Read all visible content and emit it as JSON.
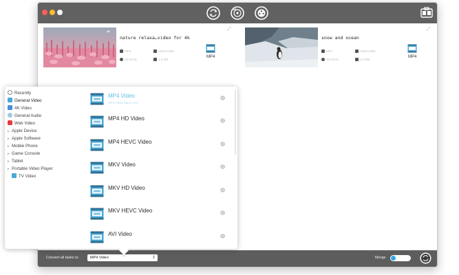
{
  "window": {
    "toolbar_icons": [
      "convert-icon",
      "burn-icon",
      "film-reel-icon",
      "toolbox-icon"
    ]
  },
  "tasks": [
    {
      "title": "nature relaxa…video for 4k",
      "meta_1": "MP4",
      "meta_2": "1920×1080",
      "meta_3": "00:00:00",
      "meta_4": "1.0 MB",
      "output_format": "MP4"
    },
    {
      "title": "snow and  ocean",
      "meta_1": "MP4",
      "meta_2": "1920×1080",
      "meta_3": "00:00:00",
      "meta_4": "1.0 MB",
      "output_format": "MP4"
    }
  ],
  "categories": [
    {
      "label": "Recently",
      "icon": "clock-icon",
      "expandable": false
    },
    {
      "label": "General Video",
      "icon": "video-icon",
      "expandable": false,
      "active": true
    },
    {
      "label": "4K Video",
      "icon": "4k-icon",
      "expandable": false
    },
    {
      "label": "General Audio",
      "icon": "music-note-icon",
      "expandable": false
    },
    {
      "label": "Web Video",
      "icon": "youtube-icon",
      "expandable": false
    },
    {
      "label": "Apple Device",
      "icon": "",
      "expandable": true
    },
    {
      "label": "Apple Software",
      "icon": "",
      "expandable": true
    },
    {
      "label": "Mobile Phone",
      "icon": "",
      "expandable": true
    },
    {
      "label": "Game Console",
      "icon": "",
      "expandable": true
    },
    {
      "label": "Tablet",
      "icon": "",
      "expandable": true
    },
    {
      "label": "Portable Video Player",
      "icon": "",
      "expandable": true
    },
    {
      "label": "TV Video",
      "icon": "tv-icon",
      "expandable": false
    }
  ],
  "formats": [
    {
      "name": "MP4 Video",
      "sub": "MP4    H264    Same    AAC",
      "selected": true
    },
    {
      "name": "MP4 HD Video",
      "sub": "",
      "selected": false
    },
    {
      "name": "MP4 HEVC Video",
      "sub": "",
      "selected": false
    },
    {
      "name": "MKV Video",
      "sub": "",
      "selected": false
    },
    {
      "name": "MKV HD Video",
      "sub": "",
      "selected": false
    },
    {
      "name": "MKV HEVC Video",
      "sub": "",
      "selected": false
    },
    {
      "name": "AVI Video",
      "sub": "",
      "selected": false
    }
  ],
  "bottom": {
    "convert_label": "Convert all tasks to",
    "selected_format": "MP4 Video",
    "merge_label": "Merge",
    "merge_on": true
  },
  "colors": {
    "accent": "#33a6e6",
    "titlebar": "#616161",
    "bottombar": "#5d5d5d"
  }
}
